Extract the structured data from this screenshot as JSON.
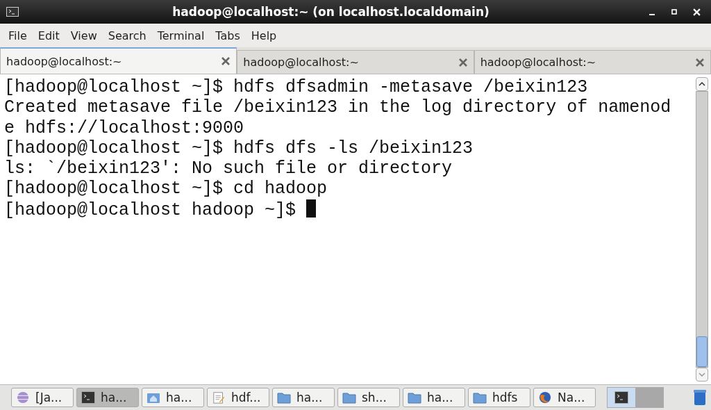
{
  "window": {
    "title": "hadoop@localhost:~ (on localhost.localdomain)"
  },
  "menu": [
    "File",
    "Edit",
    "View",
    "Search",
    "Terminal",
    "Tabs",
    "Help"
  ],
  "tabs": [
    {
      "label": "hadoop@localhost:~",
      "selected": true
    },
    {
      "label": "hadoop@localhost:~",
      "selected": false
    },
    {
      "label": "hadoop@localhost:~",
      "selected": false
    }
  ],
  "terminal": {
    "lines": [
      "[hadoop@localhost ~]$ hdfs dfsadmin -metasave /beixin123",
      "Created metasave file /beixin123 in the log directory of namenod",
      "e hdfs://localhost:9000",
      "[hadoop@localhost ~]$ hdfs dfs -ls /beixin123",
      "ls: `/beixin123': No such file or directory",
      "[hadoop@localhost ~]$ cd hadoop",
      "[hadoop@localhost hadoop ~]$ "
    ]
  },
  "taskbar": [
    {
      "kind": "globe",
      "label": "[Ja...",
      "selected": false
    },
    {
      "kind": "terminal",
      "label": "ha...",
      "selected": true
    },
    {
      "kind": "home",
      "label": "ha...",
      "selected": false
    },
    {
      "kind": "editor",
      "label": "hdf...",
      "selected": false
    },
    {
      "kind": "folder",
      "label": "ha...",
      "selected": false
    },
    {
      "kind": "folder",
      "label": "sh...",
      "selected": false
    },
    {
      "kind": "folder",
      "label": "ha...",
      "selected": false
    },
    {
      "kind": "folder",
      "label": "hdfs",
      "selected": false
    },
    {
      "kind": "browser",
      "label": "Na...",
      "selected": false
    }
  ]
}
